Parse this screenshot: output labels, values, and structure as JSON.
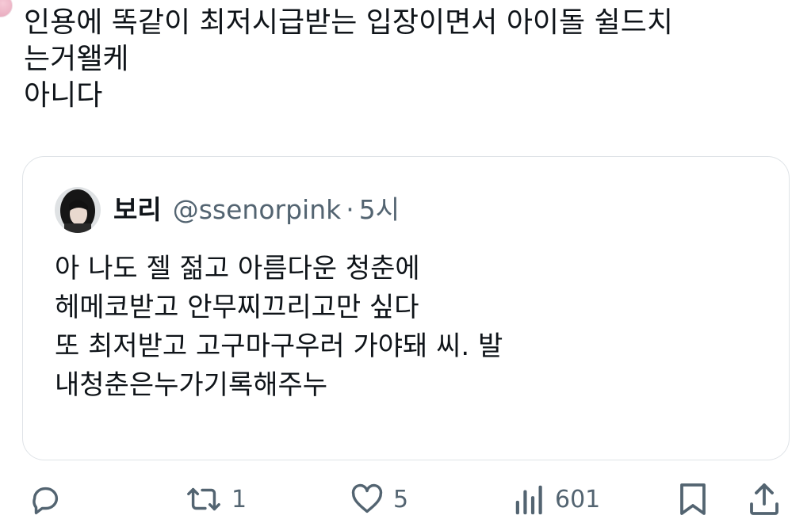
{
  "tweet": {
    "lines": [
      "인용에 똑같이 최저시급받는 입장이면서 아이돌 쉴드치",
      "는거왤케",
      "아니다"
    ]
  },
  "quote": {
    "name": "보리",
    "handle": "@ssenorpink",
    "separator": "·",
    "time": "5시",
    "lines": [
      "아 나도 젤 젊고 아름다운 청춘에",
      "헤메코받고 안무찌끄리고만 싶다",
      "또 최저받고 고구마구우러 가야돼 씨. 발",
      "내청춘은누가기록해주누"
    ]
  },
  "actions": {
    "reply_count": "",
    "retweet_count": "1",
    "like_count": "5",
    "views_count": "601"
  },
  "icons": {
    "reply": "reply-icon",
    "retweet": "retweet-icon",
    "like": "heart-icon",
    "views": "views-icon",
    "bookmark": "bookmark-icon",
    "share": "share-icon"
  },
  "colors": {
    "text": "#0f1419",
    "secondary": "#536471",
    "border": "#dfe3e7"
  }
}
